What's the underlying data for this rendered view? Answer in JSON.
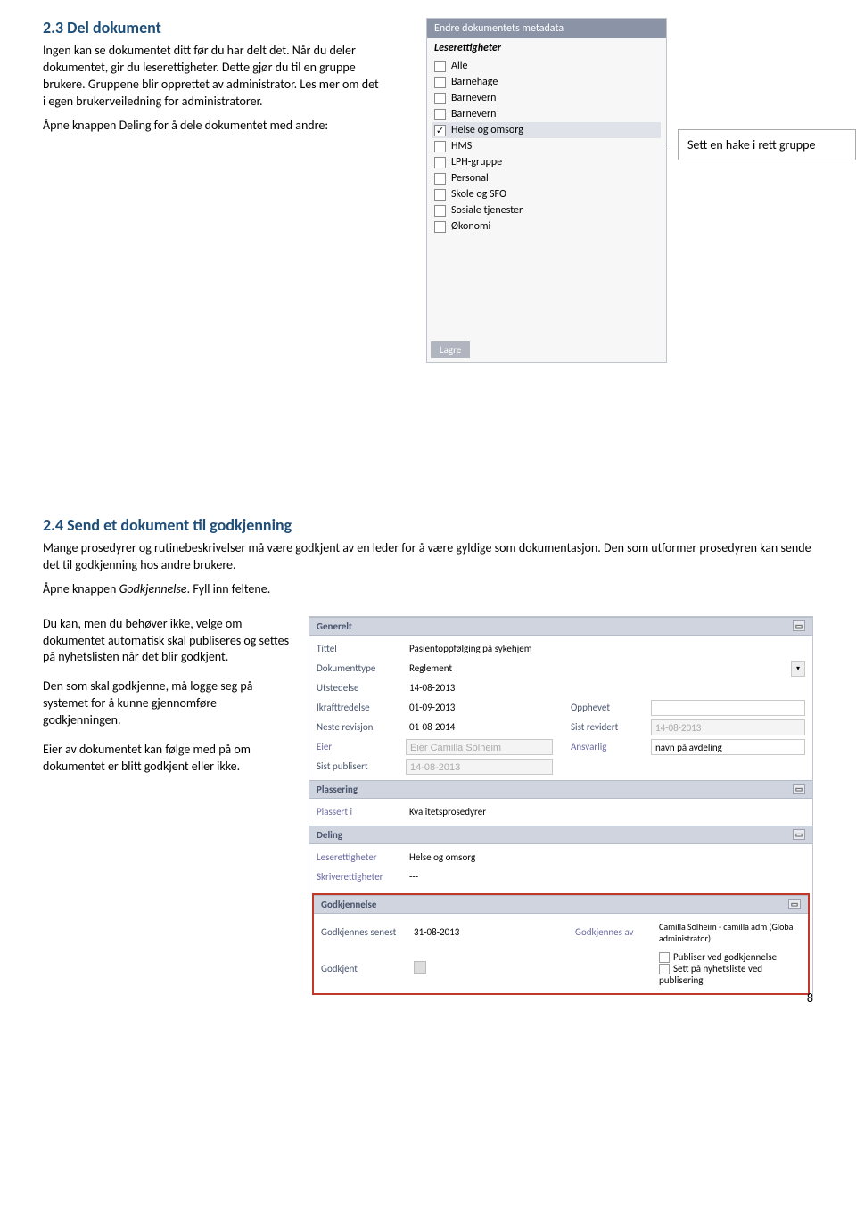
{
  "section23": {
    "heading": "2.3 Del dokument",
    "p1": "Ingen kan se dokumentet ditt før du har delt det. Når du deler dokumentet, gir du leserettigheter. Dette gjør du til en gruppe brukere. Gruppene blir opprettet av administrator. Les mer om det i egen brukerveiledning for administratorer.",
    "p2": "Åpne knappen Deling for å dele dokumentet med andre:"
  },
  "meta_panel": {
    "header": "Endre dokumentets metadata",
    "sub": "Leserettigheter",
    "items": [
      "Alle",
      "Barnehage",
      "Barnevern",
      "Barnevern",
      "Helse og omsorg",
      "HMS",
      "LPH-gruppe",
      "Personal",
      "Skole og SFO",
      "Sosiale tjenester",
      "Økonomi"
    ],
    "checked_index": 4,
    "save": "Lagre"
  },
  "callout": "Sett en hake i rett gruppe",
  "section24": {
    "heading": "2.4 Send et dokument til godkjenning",
    "p1": "Mange prosedyrer og rutinebeskrivelser må være godkjent av en leder for å være gyldige som dokumentasjon. Den som utformer prosedyren kan sende det til godkjenning hos andre brukere.",
    "p2a": "Åpne knappen ",
    "p2b": "Godkjennelse",
    "p2c": ". Fyll inn feltene.",
    "left_p1": "Du kan, men du behøver ikke, velge om dokumentet automatisk skal publiseres og settes på nyhetslisten når det blir godkjent.",
    "left_p2": "Den som skal godkjenne, må logge seg på systemet for å kunne gjennomføre godkjenningen.",
    "left_p3": "Eier av dokumentet kan følge med på om dokumentet er blitt godkjent eller ikke."
  },
  "form": {
    "sec_generelt": "Generelt",
    "tittel_lbl": "Tittel",
    "tittel_val": "Pasientoppfølging på sykehjem",
    "doktype_lbl": "Dokumenttype",
    "doktype_val": "Reglement",
    "utstedelse_lbl": "Utstedelse",
    "utstedelse_val": "14-08-2013",
    "ikraft_lbl": "Ikrafttredelse",
    "ikraft_val": "01-09-2013",
    "opphevet_lbl": "Opphevet",
    "neste_lbl": "Neste revisjon",
    "neste_val": "01-08-2014",
    "sistrev_lbl": "Sist revidert",
    "sistrev_val": "14-08-2013",
    "eier_lbl": "Eier",
    "eier_val": "Eier Camilla Solheim",
    "ansvarlig_lbl": "Ansvarlig",
    "ansvarlig_val": "navn på avdeling",
    "sistpub_lbl": "Sist publisert",
    "sistpub_val": "14-08-2013",
    "sec_plassering": "Plassering",
    "plassert_lbl": "Plassert i",
    "plassert_val": "Kvalitetsprosedyrer",
    "sec_deling": "Deling",
    "leser_lbl": "Leserettigheter",
    "leser_val": "Helse og omsorg",
    "skriver_lbl": "Skriverettigheter",
    "skriver_val": "---",
    "sec_godkj": "Godkjennelse",
    "godkj_senest_lbl": "Godkjennes senest",
    "godkj_senest_val": "31-08-2013",
    "godkj_av_lbl": "Godkjennes av",
    "godkj_av_val": "Camilla Solheim - camilla adm (Global administrator)",
    "godkjent_lbl": "Godkjent",
    "opt1": "Publiser ved godkjennelse",
    "opt2": "Sett på nyhetsliste ved publisering"
  },
  "pagenum": "8"
}
